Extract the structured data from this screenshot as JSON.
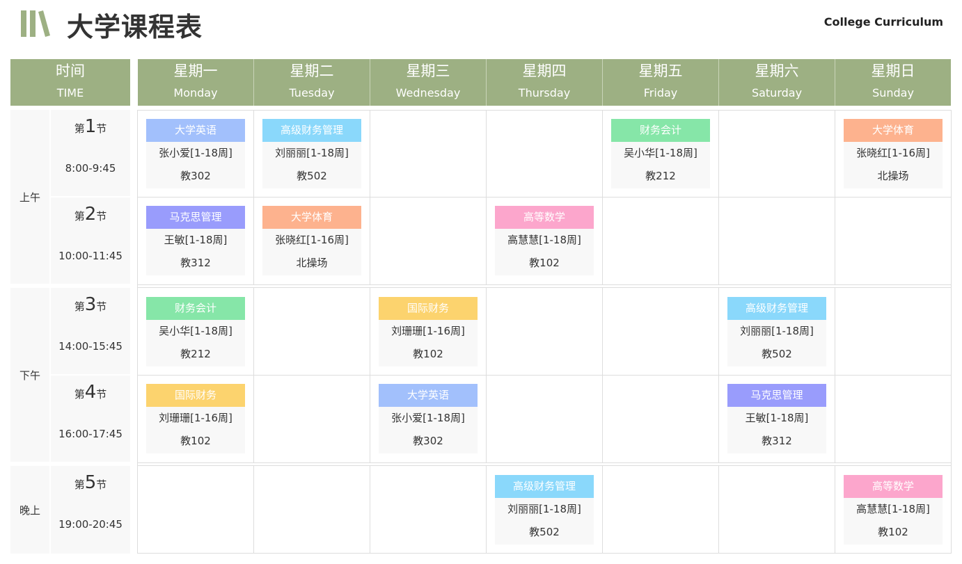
{
  "header": {
    "title": "大学课程表",
    "subtitle": "College Curriculum"
  },
  "time_header": {
    "cn": "时间",
    "en": "TIME"
  },
  "days": [
    {
      "cn": "星期一",
      "en": "Monday"
    },
    {
      "cn": "星期二",
      "en": "Tuesday"
    },
    {
      "cn": "星期三",
      "en": "Wednesday"
    },
    {
      "cn": "星期四",
      "en": "Thursday"
    },
    {
      "cn": "星期五",
      "en": "Friday"
    },
    {
      "cn": "星期六",
      "en": "Saturday"
    },
    {
      "cn": "星期日",
      "en": "Sunday"
    }
  ],
  "periods": [
    {
      "label": "上午"
    },
    {
      "label": "下午"
    },
    {
      "label": "晚上"
    }
  ],
  "slots": [
    {
      "prefix": "第",
      "num": "1",
      "suffix": "节",
      "time": "8:00-9:45"
    },
    {
      "prefix": "第",
      "num": "2",
      "suffix": "节",
      "time": "10:00-11:45"
    },
    {
      "prefix": "第",
      "num": "3",
      "suffix": "节",
      "time": "14:00-15:45"
    },
    {
      "prefix": "第",
      "num": "4",
      "suffix": "节",
      "time": "16:00-17:45"
    },
    {
      "prefix": "第",
      "num": "5",
      "suffix": "节",
      "time": "19:00-20:45"
    }
  ],
  "courses": [
    {
      "slot": 0,
      "day": 0,
      "name": "大学英语",
      "teacher": "张小爱[1-18周]",
      "room": "教302",
      "color": "#a2c0fc"
    },
    {
      "slot": 0,
      "day": 1,
      "name": "高级财务管理",
      "teacher": "刘丽丽[1-18周]",
      "room": "教502",
      "color": "#8ad8fb"
    },
    {
      "slot": 0,
      "day": 4,
      "name": "财务会计",
      "teacher": "吴小华[1-18周]",
      "room": "教212",
      "color": "#86e6a8"
    },
    {
      "slot": 0,
      "day": 6,
      "name": "大学体育",
      "teacher": "张晓红[1-16周]",
      "room": "北操场",
      "color": "#fdb28e"
    },
    {
      "slot": 1,
      "day": 0,
      "name": "马克思管理",
      "teacher": "王敏[1-18周]",
      "room": "教312",
      "color": "#999cfc"
    },
    {
      "slot": 1,
      "day": 1,
      "name": "大学体育",
      "teacher": "张晓红[1-16周]",
      "room": "北操场",
      "color": "#fdb28e"
    },
    {
      "slot": 1,
      "day": 3,
      "name": "高等数学",
      "teacher": "高慧慧[1-18周]",
      "room": "教102",
      "color": "#fca6cc"
    },
    {
      "slot": 2,
      "day": 0,
      "name": "财务会计",
      "teacher": "吴小华[1-18周]",
      "room": "教212",
      "color": "#86e6a8"
    },
    {
      "slot": 2,
      "day": 2,
      "name": "国际财务",
      "teacher": "刘珊珊[1-16周]",
      "room": "教102",
      "color": "#fcd36e"
    },
    {
      "slot": 2,
      "day": 5,
      "name": "高级财务管理",
      "teacher": "刘丽丽[1-18周]",
      "room": "教502",
      "color": "#8ad8fb"
    },
    {
      "slot": 3,
      "day": 0,
      "name": "国际财务",
      "teacher": "刘珊珊[1-16周]",
      "room": "教102",
      "color": "#fcd36e"
    },
    {
      "slot": 3,
      "day": 2,
      "name": "大学英语",
      "teacher": "张小爱[1-18周]",
      "room": "教302",
      "color": "#a2c0fc"
    },
    {
      "slot": 3,
      "day": 5,
      "name": "马克思管理",
      "teacher": "王敏[1-18周]",
      "room": "教312",
      "color": "#999cfc"
    },
    {
      "slot": 4,
      "day": 3,
      "name": "高级财务管理",
      "teacher": "刘丽丽[1-18周]",
      "room": "教502",
      "color": "#8ad8fb"
    },
    {
      "slot": 4,
      "day": 6,
      "name": "高等数学",
      "teacher": "高慧慧[1-18周]",
      "room": "教102",
      "color": "#fca6cc"
    }
  ],
  "colors": {
    "header_bg": "#9db083",
    "logo": "#9db083"
  }
}
